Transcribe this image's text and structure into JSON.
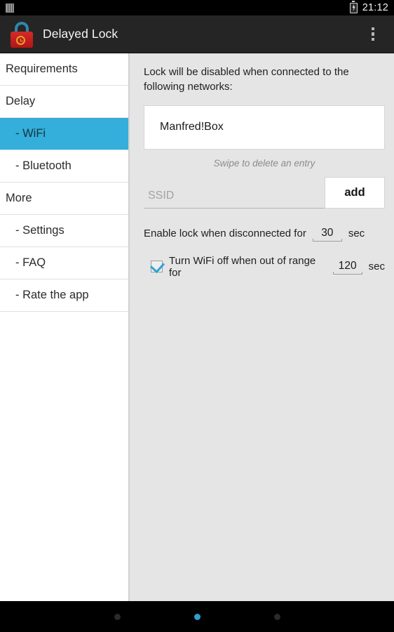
{
  "status_bar": {
    "storage_icon": "sd-card-icon",
    "battery_icon": "battery-charging-icon",
    "time": "21:12"
  },
  "action_bar": {
    "app_icon": "padlock-clock-icon",
    "title": "Delayed Lock",
    "overflow_icon": "overflow-menu-icon"
  },
  "sidebar": {
    "items": [
      {
        "label": "Requirements",
        "level": "top",
        "selected": false
      },
      {
        "label": "Delay",
        "level": "top",
        "selected": false
      },
      {
        "label": "- WiFi",
        "level": "sub",
        "selected": true
      },
      {
        "label": "- Bluetooth",
        "level": "sub",
        "selected": false
      },
      {
        "label": "More",
        "level": "top",
        "selected": false
      },
      {
        "label": "- Settings",
        "level": "sub",
        "selected": false
      },
      {
        "label": "- FAQ",
        "level": "sub",
        "selected": false
      },
      {
        "label": "- Rate the app",
        "level": "sub",
        "selected": false
      }
    ]
  },
  "main": {
    "intro_text": "Lock will be disabled when connected to the following networks:",
    "networks": [
      {
        "ssid": "Manfred!Box"
      }
    ],
    "swipe_hint": "Swipe to delete an entry",
    "ssid_input": {
      "value": "",
      "placeholder": "SSID"
    },
    "add_button_label": "add",
    "disconnect_setting": {
      "label": "Enable lock when disconnected for",
      "value": "30",
      "unit": "sec"
    },
    "wifi_off_setting": {
      "checked": true,
      "label": "Turn WiFi off when out of range for",
      "value": "120",
      "unit": "sec"
    }
  },
  "nav_bar": {
    "back_label": "back-dot",
    "home_label": "home-dot",
    "recents_label": "recents-dot"
  },
  "colors": {
    "accent": "#34aedb",
    "action_bar": "#252525",
    "panel_bg": "#e5e5e5",
    "checkbox_check": "#2aa5d4"
  }
}
